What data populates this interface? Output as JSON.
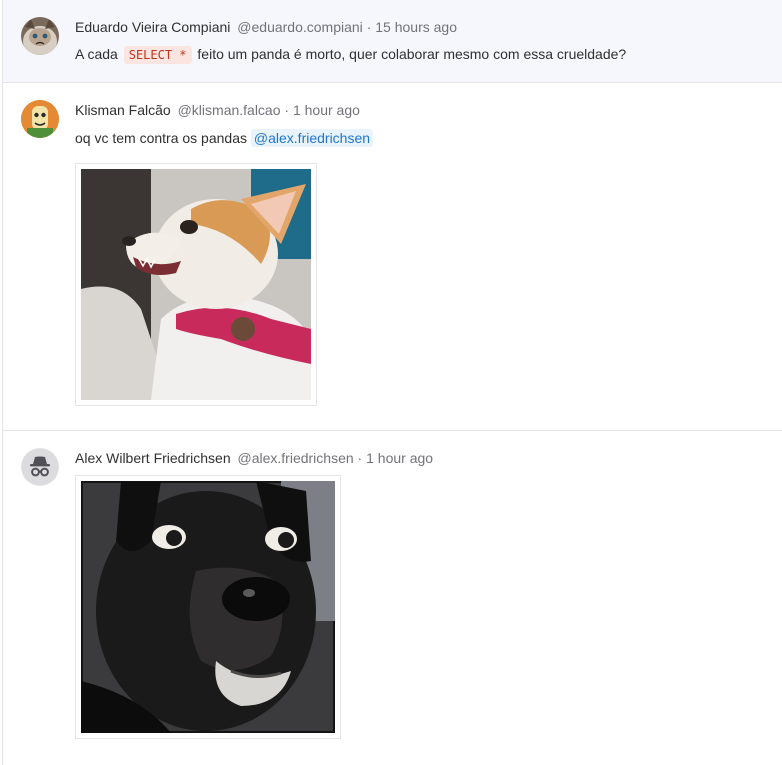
{
  "notes": [
    {
      "author_name": "Eduardo Vieira Compiani",
      "author_username": "@eduardo.compiani",
      "separator": "·",
      "time": "15 hours ago",
      "text_before": "A cada",
      "code": "SELECT *",
      "text_after": "feito um panda é morto, quer colaborar mesmo com essa crueldade?",
      "avatar": "grumpy-cat-avatar"
    },
    {
      "author_name": "Klisman Falcão",
      "author_username": "@klisman.falcao",
      "separator": "·",
      "time": "1 hour ago",
      "text_before": "oq vc tem contra os pandas",
      "mention": "@alex.friedrichsen",
      "attachment": "angry-chihuahua-image",
      "avatar": "cartoon-avatar"
    },
    {
      "author_name": "Alex Wilbert Friedrichsen",
      "author_username": "@alex.friedrichsen",
      "separator": "·",
      "time": "1 hour ago",
      "attachment": "shocked-black-dog-image",
      "avatar": "incognito-icon"
    }
  ],
  "colors": {
    "highlight_bg": "#f5f7fd",
    "muted_text": "#737278",
    "mention_text": "#1f75cb",
    "code_text": "#c0341d"
  }
}
